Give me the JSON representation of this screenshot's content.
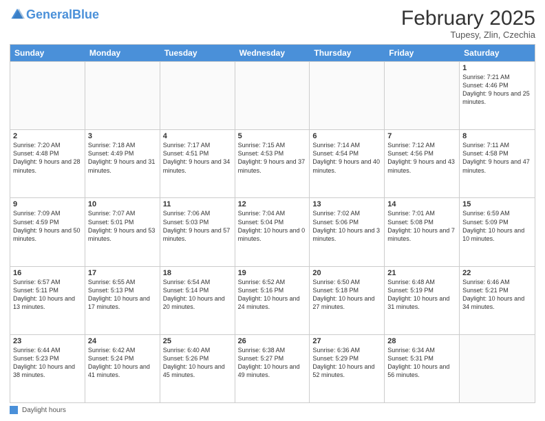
{
  "header": {
    "logo_general": "General",
    "logo_blue": "Blue",
    "month_title": "February 2025",
    "location": "Tupesy, Zlin, Czechia"
  },
  "days_of_week": [
    "Sunday",
    "Monday",
    "Tuesday",
    "Wednesday",
    "Thursday",
    "Friday",
    "Saturday"
  ],
  "weeks": [
    [
      {
        "day": "",
        "sunrise": "",
        "sunset": "",
        "daylight": ""
      },
      {
        "day": "",
        "sunrise": "",
        "sunset": "",
        "daylight": ""
      },
      {
        "day": "",
        "sunrise": "",
        "sunset": "",
        "daylight": ""
      },
      {
        "day": "",
        "sunrise": "",
        "sunset": "",
        "daylight": ""
      },
      {
        "day": "",
        "sunrise": "",
        "sunset": "",
        "daylight": ""
      },
      {
        "day": "",
        "sunrise": "",
        "sunset": "",
        "daylight": ""
      },
      {
        "day": "1",
        "sunrise": "Sunrise: 7:21 AM",
        "sunset": "Sunset: 4:46 PM",
        "daylight": "Daylight: 9 hours and 25 minutes."
      }
    ],
    [
      {
        "day": "2",
        "sunrise": "Sunrise: 7:20 AM",
        "sunset": "Sunset: 4:48 PM",
        "daylight": "Daylight: 9 hours and 28 minutes."
      },
      {
        "day": "3",
        "sunrise": "Sunrise: 7:18 AM",
        "sunset": "Sunset: 4:49 PM",
        "daylight": "Daylight: 9 hours and 31 minutes."
      },
      {
        "day": "4",
        "sunrise": "Sunrise: 7:17 AM",
        "sunset": "Sunset: 4:51 PM",
        "daylight": "Daylight: 9 hours and 34 minutes."
      },
      {
        "day": "5",
        "sunrise": "Sunrise: 7:15 AM",
        "sunset": "Sunset: 4:53 PM",
        "daylight": "Daylight: 9 hours and 37 minutes."
      },
      {
        "day": "6",
        "sunrise": "Sunrise: 7:14 AM",
        "sunset": "Sunset: 4:54 PM",
        "daylight": "Daylight: 9 hours and 40 minutes."
      },
      {
        "day": "7",
        "sunrise": "Sunrise: 7:12 AM",
        "sunset": "Sunset: 4:56 PM",
        "daylight": "Daylight: 9 hours and 43 minutes."
      },
      {
        "day": "8",
        "sunrise": "Sunrise: 7:11 AM",
        "sunset": "Sunset: 4:58 PM",
        "daylight": "Daylight: 9 hours and 47 minutes."
      }
    ],
    [
      {
        "day": "9",
        "sunrise": "Sunrise: 7:09 AM",
        "sunset": "Sunset: 4:59 PM",
        "daylight": "Daylight: 9 hours and 50 minutes."
      },
      {
        "day": "10",
        "sunrise": "Sunrise: 7:07 AM",
        "sunset": "Sunset: 5:01 PM",
        "daylight": "Daylight: 9 hours and 53 minutes."
      },
      {
        "day": "11",
        "sunrise": "Sunrise: 7:06 AM",
        "sunset": "Sunset: 5:03 PM",
        "daylight": "Daylight: 9 hours and 57 minutes."
      },
      {
        "day": "12",
        "sunrise": "Sunrise: 7:04 AM",
        "sunset": "Sunset: 5:04 PM",
        "daylight": "Daylight: 10 hours and 0 minutes."
      },
      {
        "day": "13",
        "sunrise": "Sunrise: 7:02 AM",
        "sunset": "Sunset: 5:06 PM",
        "daylight": "Daylight: 10 hours and 3 minutes."
      },
      {
        "day": "14",
        "sunrise": "Sunrise: 7:01 AM",
        "sunset": "Sunset: 5:08 PM",
        "daylight": "Daylight: 10 hours and 7 minutes."
      },
      {
        "day": "15",
        "sunrise": "Sunrise: 6:59 AM",
        "sunset": "Sunset: 5:09 PM",
        "daylight": "Daylight: 10 hours and 10 minutes."
      }
    ],
    [
      {
        "day": "16",
        "sunrise": "Sunrise: 6:57 AM",
        "sunset": "Sunset: 5:11 PM",
        "daylight": "Daylight: 10 hours and 13 minutes."
      },
      {
        "day": "17",
        "sunrise": "Sunrise: 6:55 AM",
        "sunset": "Sunset: 5:13 PM",
        "daylight": "Daylight: 10 hours and 17 minutes."
      },
      {
        "day": "18",
        "sunrise": "Sunrise: 6:54 AM",
        "sunset": "Sunset: 5:14 PM",
        "daylight": "Daylight: 10 hours and 20 minutes."
      },
      {
        "day": "19",
        "sunrise": "Sunrise: 6:52 AM",
        "sunset": "Sunset: 5:16 PM",
        "daylight": "Daylight: 10 hours and 24 minutes."
      },
      {
        "day": "20",
        "sunrise": "Sunrise: 6:50 AM",
        "sunset": "Sunset: 5:18 PM",
        "daylight": "Daylight: 10 hours and 27 minutes."
      },
      {
        "day": "21",
        "sunrise": "Sunrise: 6:48 AM",
        "sunset": "Sunset: 5:19 PM",
        "daylight": "Daylight: 10 hours and 31 minutes."
      },
      {
        "day": "22",
        "sunrise": "Sunrise: 6:46 AM",
        "sunset": "Sunset: 5:21 PM",
        "daylight": "Daylight: 10 hours and 34 minutes."
      }
    ],
    [
      {
        "day": "23",
        "sunrise": "Sunrise: 6:44 AM",
        "sunset": "Sunset: 5:23 PM",
        "daylight": "Daylight: 10 hours and 38 minutes."
      },
      {
        "day": "24",
        "sunrise": "Sunrise: 6:42 AM",
        "sunset": "Sunset: 5:24 PM",
        "daylight": "Daylight: 10 hours and 41 minutes."
      },
      {
        "day": "25",
        "sunrise": "Sunrise: 6:40 AM",
        "sunset": "Sunset: 5:26 PM",
        "daylight": "Daylight: 10 hours and 45 minutes."
      },
      {
        "day": "26",
        "sunrise": "Sunrise: 6:38 AM",
        "sunset": "Sunset: 5:27 PM",
        "daylight": "Daylight: 10 hours and 49 minutes."
      },
      {
        "day": "27",
        "sunrise": "Sunrise: 6:36 AM",
        "sunset": "Sunset: 5:29 PM",
        "daylight": "Daylight: 10 hours and 52 minutes."
      },
      {
        "day": "28",
        "sunrise": "Sunrise: 6:34 AM",
        "sunset": "Sunset: 5:31 PM",
        "daylight": "Daylight: 10 hours and 56 minutes."
      },
      {
        "day": "",
        "sunrise": "",
        "sunset": "",
        "daylight": ""
      }
    ]
  ],
  "footer": {
    "legend_label": "Daylight hours"
  }
}
